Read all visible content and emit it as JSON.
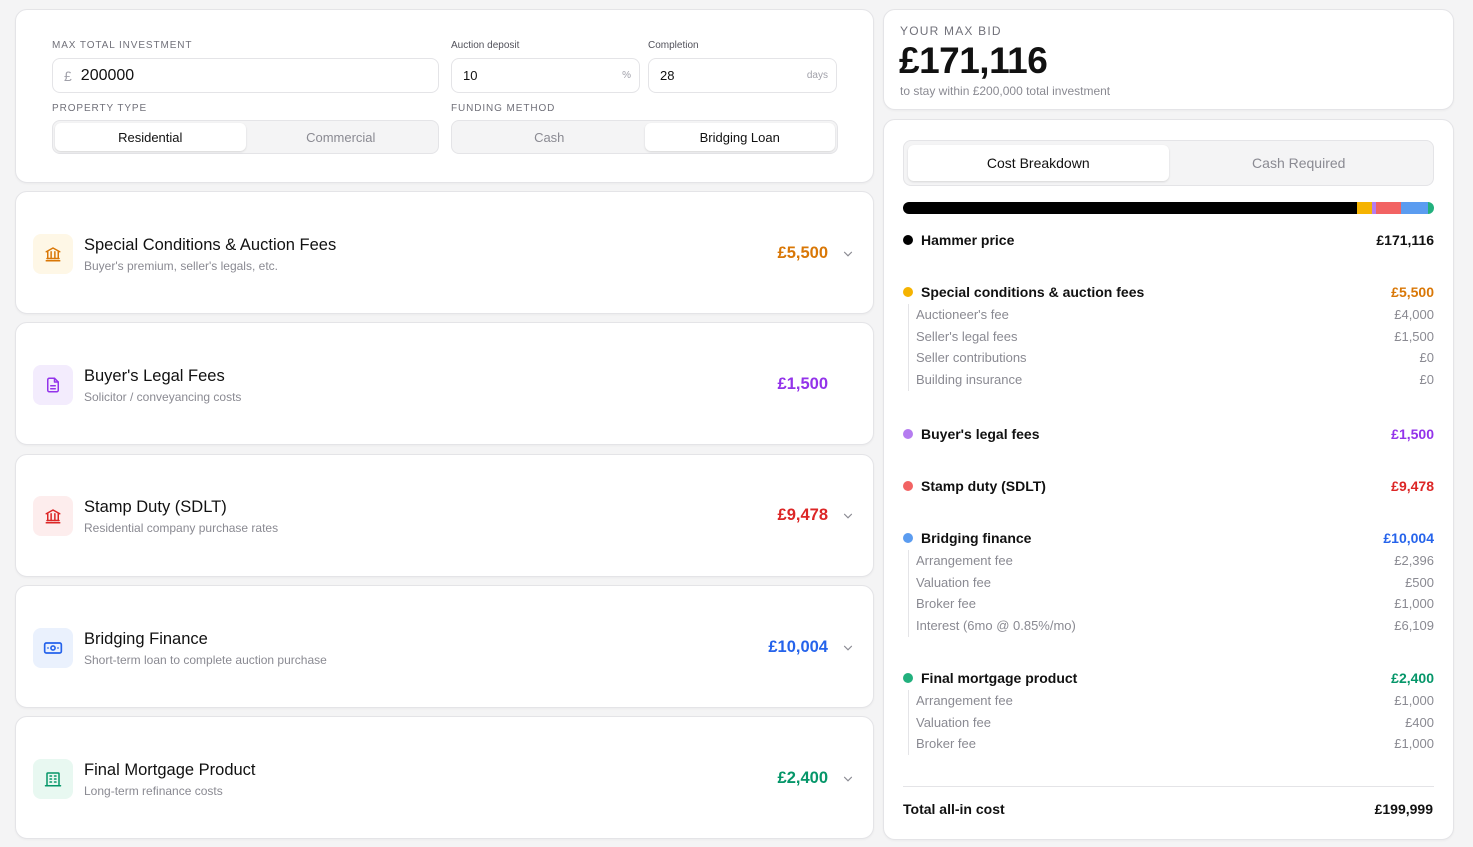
{
  "inputs": {
    "max_investment_label": "MAX TOTAL INVESTMENT",
    "currency_symbol": "£",
    "max_investment_value": "200000",
    "deposit_label": "Auction deposit",
    "deposit_value": "10",
    "deposit_unit": "%",
    "completion_label": "Completion",
    "completion_value": "28",
    "completion_unit": "days",
    "property_type_label": "PROPERTY TYPE",
    "property_types": [
      "Residential",
      "Commercial"
    ],
    "property_type_selected": "Residential",
    "funding_label": "FUNDING METHOD",
    "funding_methods": [
      "Cash",
      "Bridging Loan"
    ],
    "funding_selected": "Bridging Loan"
  },
  "cost_rows": [
    {
      "title": "Special Conditions & Auction Fees",
      "subtitle": "Buyer's premium, seller's legals, etc.",
      "amount": "£5,500",
      "color": "#d97706",
      "icon": "bank-icon",
      "expandable": true
    },
    {
      "title": "Buyer's Legal Fees",
      "subtitle": "Solicitor / conveyancing costs",
      "amount": "£1,500",
      "color": "#9333ea",
      "icon": "document-icon",
      "expandable": false
    },
    {
      "title": "Stamp Duty (SDLT)",
      "subtitle": "Residential company purchase rates",
      "amount": "£9,478",
      "color": "#dc2626",
      "icon": "bank-icon",
      "expandable": true
    },
    {
      "title": "Bridging Finance",
      "subtitle": "Short-term loan to complete auction purchase",
      "amount": "£10,004",
      "color": "#2563eb",
      "icon": "banknote-icon",
      "expandable": true
    },
    {
      "title": "Final Mortgage Product",
      "subtitle": "Long-term refinance costs",
      "amount": "£2,400",
      "color": "#059669",
      "icon": "building-icon",
      "expandable": true
    }
  ],
  "max_bid": {
    "label": "YOUR MAX BID",
    "value": "£171,116",
    "note": "to stay within £200,000 total investment"
  },
  "breakdown": {
    "tabs": [
      "Cost Breakdown",
      "Cash Required"
    ],
    "active_tab": "Cost Breakdown",
    "bar_segments": [
      {
        "name": "Hammer price",
        "value": 171116,
        "color": "#000000"
      },
      {
        "name": "Special conditions & auction fees",
        "value": 5500,
        "color": "#f5b301"
      },
      {
        "name": "Buyer's legal fees",
        "value": 1500,
        "color": "#b57cf0"
      },
      {
        "name": "Stamp duty (SDLT)",
        "value": 9478,
        "color": "#f26363"
      },
      {
        "name": "Bridging finance",
        "value": 10004,
        "color": "#5b9cf0"
      },
      {
        "name": "Final mortgage product",
        "value": 2400,
        "color": "#22b07d"
      }
    ],
    "sections": [
      {
        "name": "Hammer price",
        "amount": "£171,116",
        "dot": "#000000",
        "amount_color": "#111111",
        "items": []
      },
      {
        "name": "Special conditions & auction fees",
        "amount": "£5,500",
        "dot": "#f5b301",
        "amount_color": "#d97706",
        "items": [
          {
            "name": "Auctioneer's fee",
            "amount": "£4,000"
          },
          {
            "name": "Seller's legal fees",
            "amount": "£1,500"
          },
          {
            "name": "Seller contributions",
            "amount": "£0"
          },
          {
            "name": "Building insurance",
            "amount": "£0"
          }
        ]
      },
      {
        "name": "Buyer's legal fees",
        "amount": "£1,500",
        "dot": "#b57cf0",
        "amount_color": "#9333ea",
        "items": []
      },
      {
        "name": "Stamp duty (SDLT)",
        "amount": "£9,478",
        "dot": "#f26363",
        "amount_color": "#dc2626",
        "items": []
      },
      {
        "name": "Bridging finance",
        "amount": "£10,004",
        "dot": "#5b9cf0",
        "amount_color": "#2563eb",
        "items": [
          {
            "name": "Arrangement fee",
            "amount": "£2,396"
          },
          {
            "name": "Valuation fee",
            "amount": "£500"
          },
          {
            "name": "Broker fee",
            "amount": "£1,000"
          },
          {
            "name": "Interest (6mo @ 0.85%/mo)",
            "amount": "£6,109"
          }
        ]
      },
      {
        "name": "Final mortgage product",
        "amount": "£2,400",
        "dot": "#22b07d",
        "amount_color": "#059669",
        "items": [
          {
            "name": "Arrangement fee",
            "amount": "£1,000"
          },
          {
            "name": "Valuation fee",
            "amount": "£400"
          },
          {
            "name": "Broker fee",
            "amount": "£1,000"
          }
        ]
      }
    ],
    "total_label": "Total all-in cost",
    "total_value": "£199,999"
  }
}
